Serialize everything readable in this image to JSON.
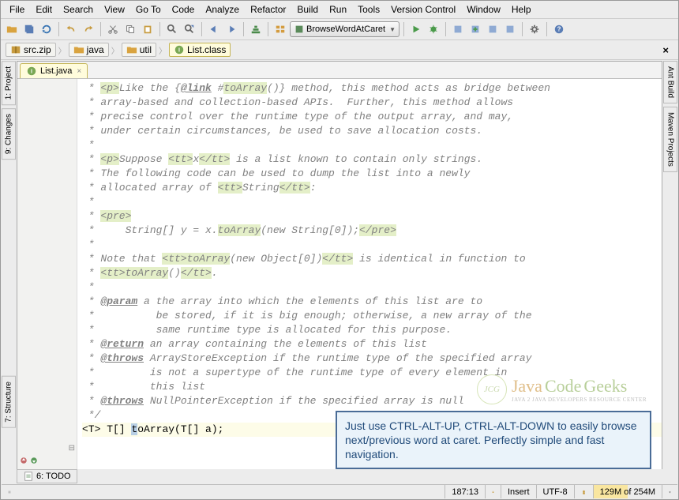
{
  "menu": [
    "File",
    "Edit",
    "Search",
    "View",
    "Go To",
    "Code",
    "Analyze",
    "Refactor",
    "Build",
    "Run",
    "Tools",
    "Version Control",
    "Window",
    "Help"
  ],
  "combo_label": "BrowseWordAtCaret",
  "breadcrumb": {
    "items": [
      {
        "icon": "archive",
        "label": "src.zip"
      },
      {
        "icon": "folder",
        "label": "java"
      },
      {
        "icon": "folder",
        "label": "util"
      },
      {
        "icon": "class",
        "label": "List.class"
      }
    ]
  },
  "editor_tab": {
    "label": "List.java",
    "icon": "class"
  },
  "side_left": [
    {
      "label": "1: Project"
    },
    {
      "label": "9: Changes"
    },
    {
      "label": "7: Structure"
    }
  ],
  "side_right": [
    {
      "label": "Ant Build"
    },
    {
      "label": "Maven Projects"
    }
  ],
  "bottom": {
    "todo": "6: TODO"
  },
  "status": {
    "pos": "187:13",
    "ins": "Insert",
    "enc": "UTF-8",
    "mem": "129M of 254M"
  },
  "tip": "Just use CTRL-ALT-UP, CTRL-ALT-DOWN to easily browse next/previous word at caret. Perfectly simple and fast navigation.",
  "wm": {
    "t1": "Java",
    "t2": "Code",
    "t3": "Geeks",
    "sub": "JAVA 2 JAVA DEVELOPERS RESOURCE CENTER"
  },
  "code": [
    " * <p>Like the {@link #toArray()} method, this method acts as bridge between",
    " * array-based and collection-based APIs.  Further, this method allows",
    " * precise control over the runtime type of the output array, and may,",
    " * under certain circumstances, be used to save allocation costs.",
    " *",
    " * <p>Suppose <tt>x</tt> is a list known to contain only strings.",
    " * The following code can be used to dump the list into a newly",
    " * allocated array of <tt>String</tt>:",
    " *",
    " * <pre>",
    " *     String[] y = x.toArray(new String[0]);</pre>",
    " *",
    " * Note that <tt>toArray(new Object[0])</tt> is identical in function to",
    " * <tt>toArray()</tt>.",
    " *",
    " * @param a the array into which the elements of this list are to",
    " *          be stored, if it is big enough; otherwise, a new array of the",
    " *          same runtime type is allocated for this purpose.",
    " * @return an array containing the elements of this list",
    " * @throws ArrayStoreException if the runtime type of the specified array",
    " *         is not a supertype of the runtime type of every element in",
    " *         this list",
    " * @throws NullPointerException if the specified array is null",
    " */"
  ],
  "method_line": "<T> T[] toArray(T[] a);"
}
